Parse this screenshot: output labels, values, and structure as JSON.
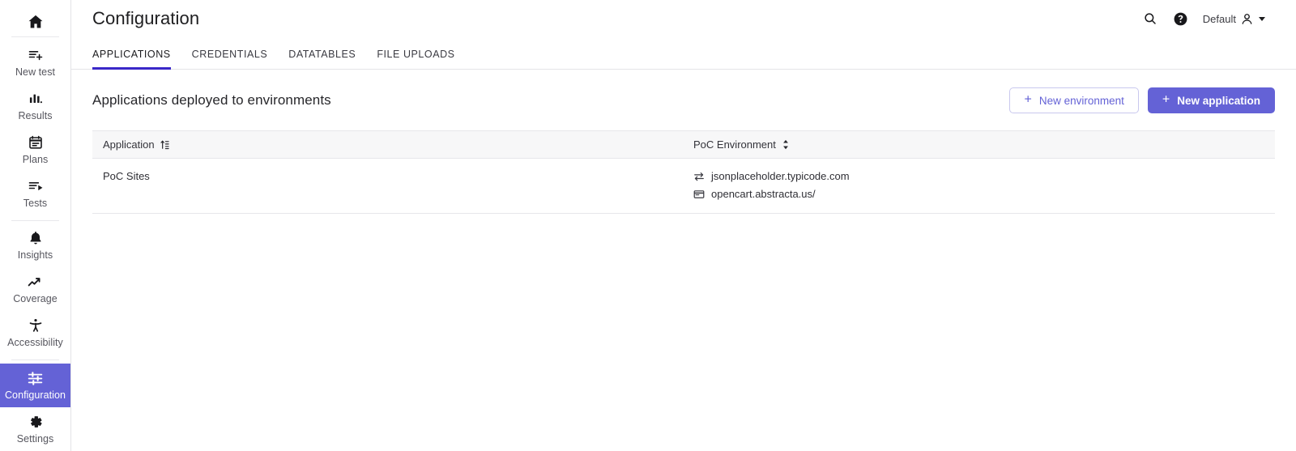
{
  "sidebar": {
    "home": {
      "label": "Home",
      "icon": "home-icon"
    },
    "groups": [
      {
        "items": [
          {
            "label": "New test",
            "icon": "new-test-icon",
            "active": false
          },
          {
            "label": "Results",
            "icon": "results-icon",
            "active": false
          },
          {
            "label": "Plans",
            "icon": "plans-icon",
            "active": false
          },
          {
            "label": "Tests",
            "icon": "tests-icon",
            "active": false
          }
        ]
      },
      {
        "items": [
          {
            "label": "Insights",
            "icon": "insights-bell-icon",
            "active": false
          },
          {
            "label": "Coverage",
            "icon": "coverage-trend-icon",
            "active": false
          },
          {
            "label": "Accessibility",
            "icon": "accessibility-icon",
            "active": false
          }
        ]
      },
      {
        "items": [
          {
            "label": "Configuration",
            "icon": "configuration-sliders-icon",
            "active": true
          },
          {
            "label": "Settings",
            "icon": "settings-gear-icon",
            "active": false
          }
        ]
      }
    ]
  },
  "header": {
    "title": "Configuration",
    "search_icon": "search-icon",
    "help_icon": "help-circle-icon",
    "user_label": "Default",
    "user_icon": "user-avatar-icon",
    "caret_icon": "chevron-down-icon"
  },
  "tabs": [
    {
      "label": "APPLICATIONS",
      "active": true
    },
    {
      "label": "CREDENTIALS",
      "active": false
    },
    {
      "label": "DATATABLES",
      "active": false
    },
    {
      "label": "FILE UPLOADS",
      "active": false
    }
  ],
  "content": {
    "section_title": "Applications deployed to environments",
    "buttons": {
      "new_environment": "New environment",
      "new_application": "New application",
      "plus_glyph": "+"
    },
    "table": {
      "columns": [
        {
          "label": "Application",
          "sort_icon": "sort-ascending-icon"
        },
        {
          "label": "PoC Environment",
          "sort_icon": "sort-updown-icon"
        }
      ],
      "rows": [
        {
          "application": "PoC Sites",
          "environments": [
            {
              "name": "jsonplaceholder.typicode.com",
              "icon": "api-transfer-icon"
            },
            {
              "name": "opencart.abstracta.us/",
              "icon": "browser-window-icon"
            }
          ]
        }
      ]
    }
  },
  "colors": {
    "accent_purple": "#6462d6",
    "tab_underline": "#3a28c8",
    "border": "#e4e4e7",
    "header_row_bg": "#f7f7f8"
  }
}
